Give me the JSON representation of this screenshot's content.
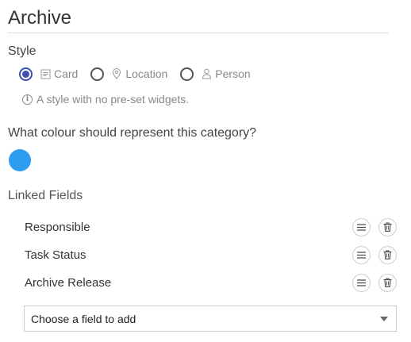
{
  "page": {
    "title": "Archive"
  },
  "style": {
    "label": "Style",
    "options": [
      {
        "label": "Card",
        "icon": "card-icon",
        "selected": true
      },
      {
        "label": "Location",
        "icon": "location-pin-icon",
        "selected": false
      },
      {
        "label": "Person",
        "icon": "person-icon",
        "selected": false
      }
    ],
    "info_text": "A style with no pre-set widgets."
  },
  "colour": {
    "question": "What colour should represent this category?",
    "value": "#2e9df1"
  },
  "linked_fields": {
    "label": "Linked Fields",
    "items": [
      {
        "name": "Responsible"
      },
      {
        "name": "Task Status"
      },
      {
        "name": "Archive Release"
      }
    ],
    "add_select": {
      "placeholder": "Choose a field to add"
    }
  },
  "colors": {
    "accent": "#3f51b5",
    "muted_text": "#888888"
  }
}
